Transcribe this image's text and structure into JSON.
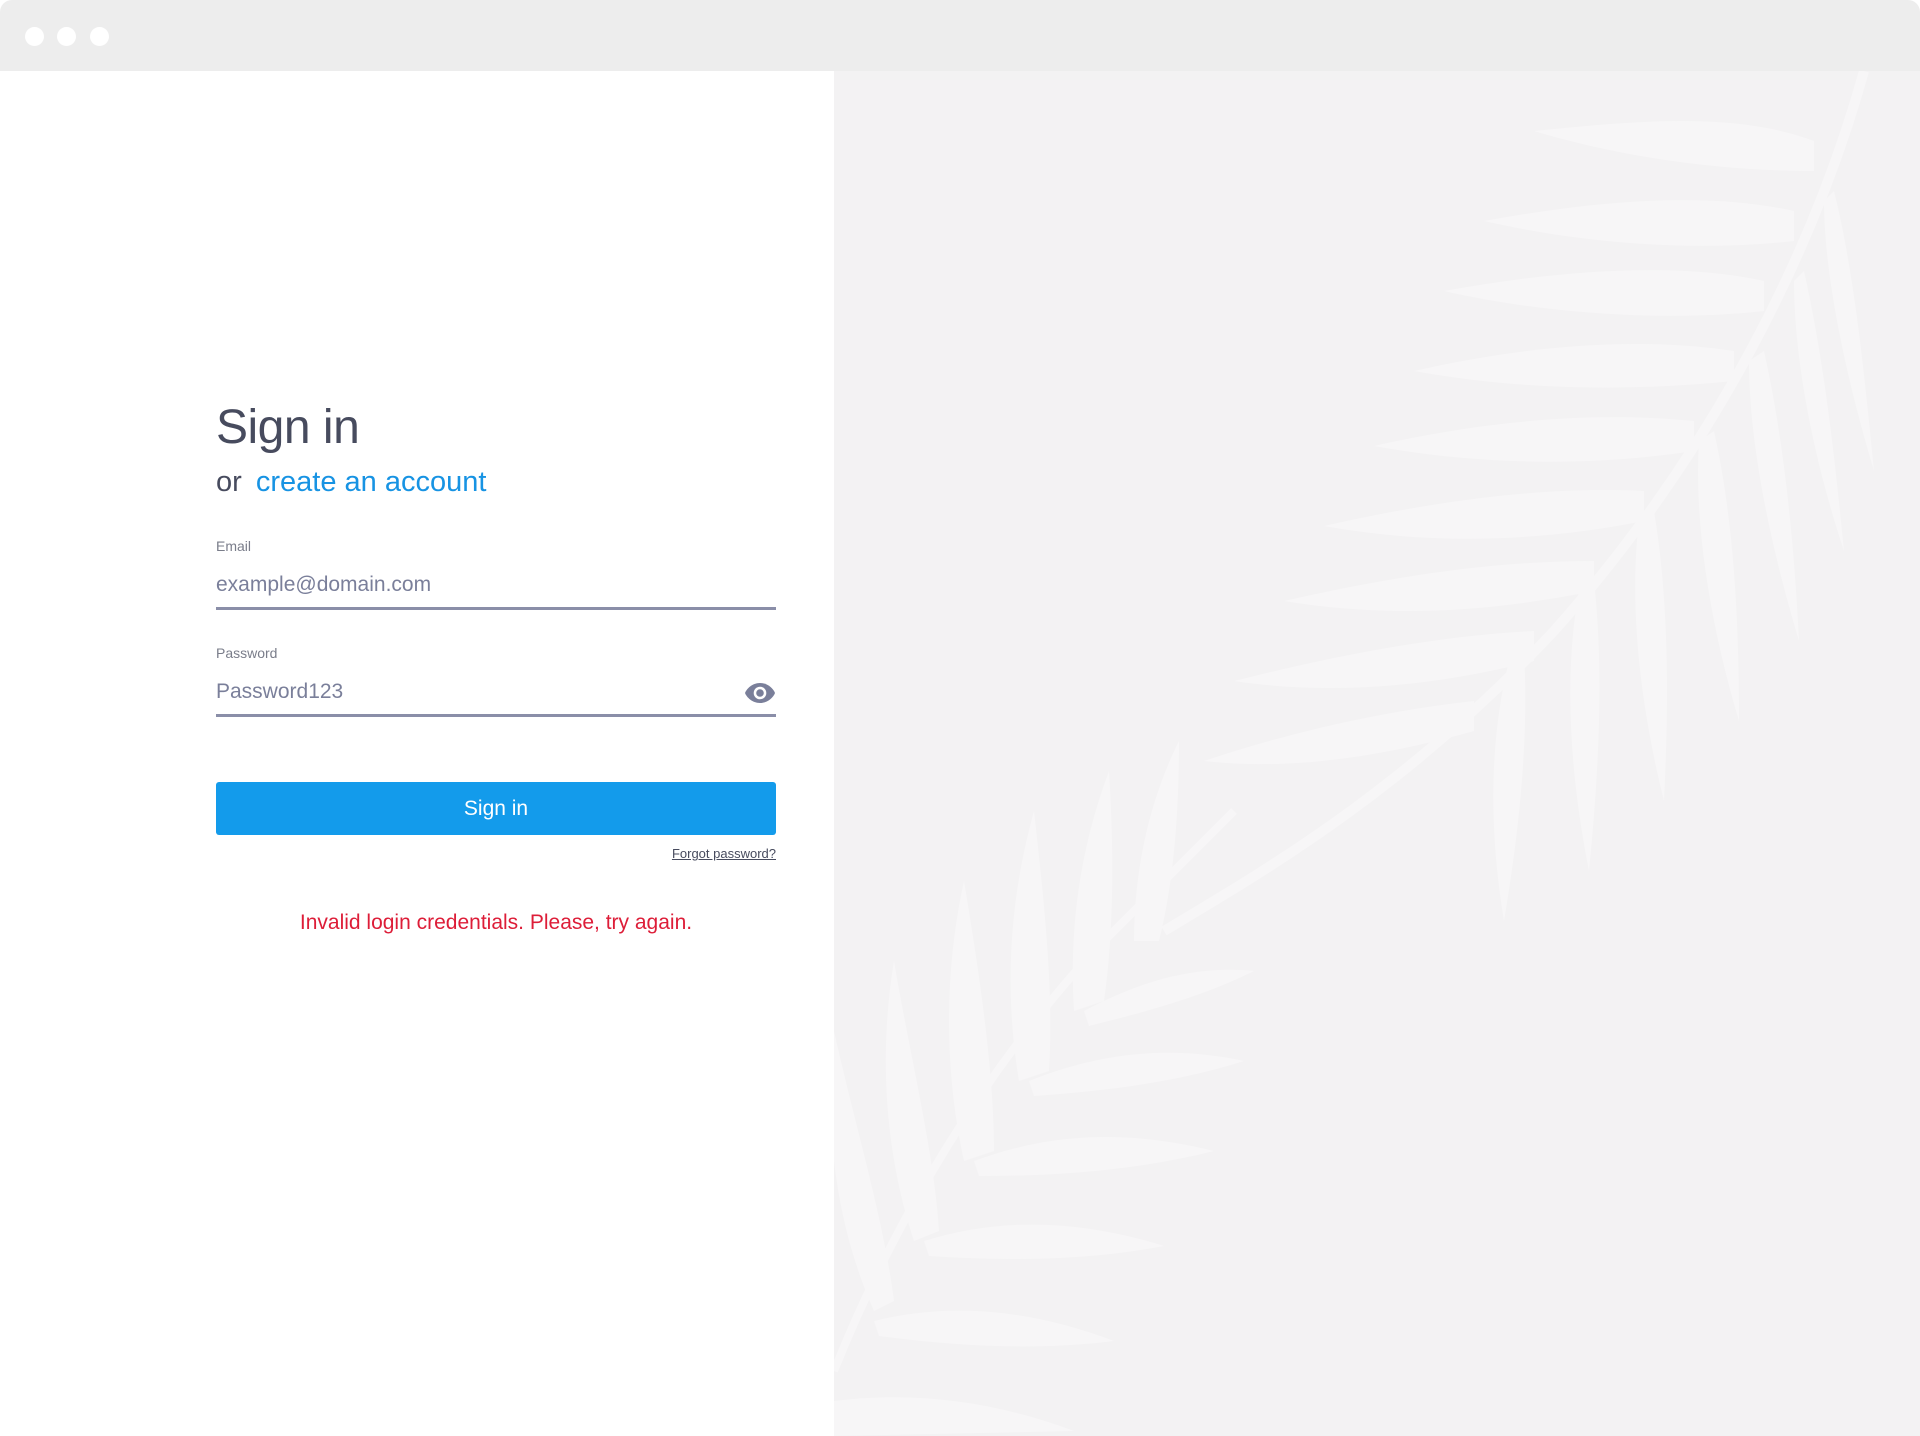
{
  "window": {
    "traffic_lights": [
      "close",
      "minimize",
      "maximize"
    ]
  },
  "signin": {
    "title": "Sign in",
    "or_text": "or",
    "create_account_link": "create an account",
    "email": {
      "label": "Email",
      "placeholder": "example@domain.com",
      "value": ""
    },
    "password": {
      "label": "Password",
      "placeholder": "",
      "value": "Password123",
      "toggle_icon": "eye-icon"
    },
    "submit_label": "Sign in",
    "forgot_password": "Forgot password?",
    "error_message": "Invalid login credentials. Please, try again."
  },
  "colors": {
    "accent": "#139beb",
    "link": "#1793e3",
    "error": "#dd1d38",
    "text": "#474b5e",
    "right_panel_bg": "#f3f2f3",
    "titlebar_bg": "#ededed"
  }
}
